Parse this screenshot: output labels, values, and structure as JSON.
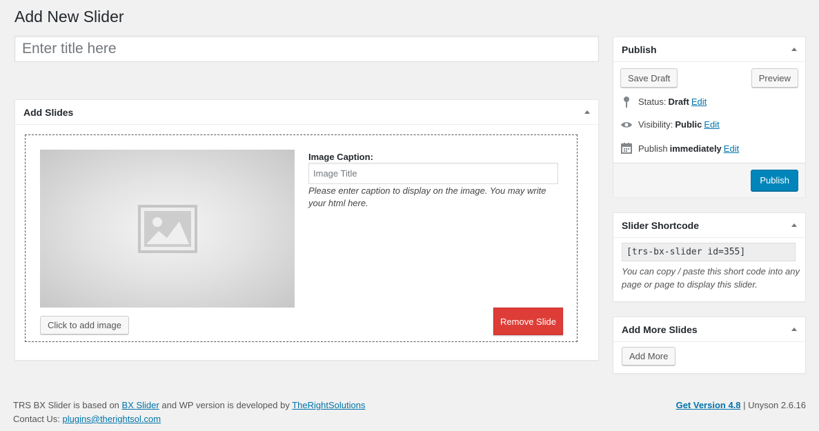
{
  "page_title": "Add New Slider",
  "title_input": {
    "placeholder": "Enter title here",
    "value": ""
  },
  "add_slides": {
    "heading": "Add Slides",
    "slide": {
      "add_image_label": "Click to add image",
      "caption_label": "Image Caption:",
      "caption_placeholder": "Image Title",
      "caption_value": "",
      "caption_help": "Please enter caption to display on the image. You may write your html here.",
      "remove_label": "Remove Slide"
    }
  },
  "publish": {
    "heading": "Publish",
    "save_draft_label": "Save Draft",
    "preview_label": "Preview",
    "status_label": "Status:",
    "status_value": "Draft",
    "visibility_label": "Visibility:",
    "visibility_value": "Public",
    "publish_label": "Publish",
    "publish_value": "immediately",
    "edit_label": "Edit",
    "publish_button_label": "Publish",
    "icons": [
      "pin-icon",
      "eye-icon",
      "calendar-icon"
    ]
  },
  "shortcode": {
    "heading": "Slider Shortcode",
    "value": "[trs-bx-slider id=355]",
    "help": "You can copy / paste this short code into any page or page to display this slider."
  },
  "add_more": {
    "heading": "Add More Slides",
    "button_label": "Add More"
  },
  "footer": {
    "text_1": "TRS BX Slider is based on",
    "link_bx": "BX Slider",
    "text_2": "and WP version is developed by",
    "link_dev": "TheRightSolutions",
    "contact_label": "Contact Us:",
    "contact_email": "plugins@therightsol.com",
    "get_version": "Get Version 4.8",
    "separator": "|",
    "unyson": "Unyson 2.6.16"
  },
  "colors": {
    "primary": "#0085ba",
    "danger": "#dd3d36",
    "link": "#0073aa",
    "background": "#f1f1f1"
  }
}
